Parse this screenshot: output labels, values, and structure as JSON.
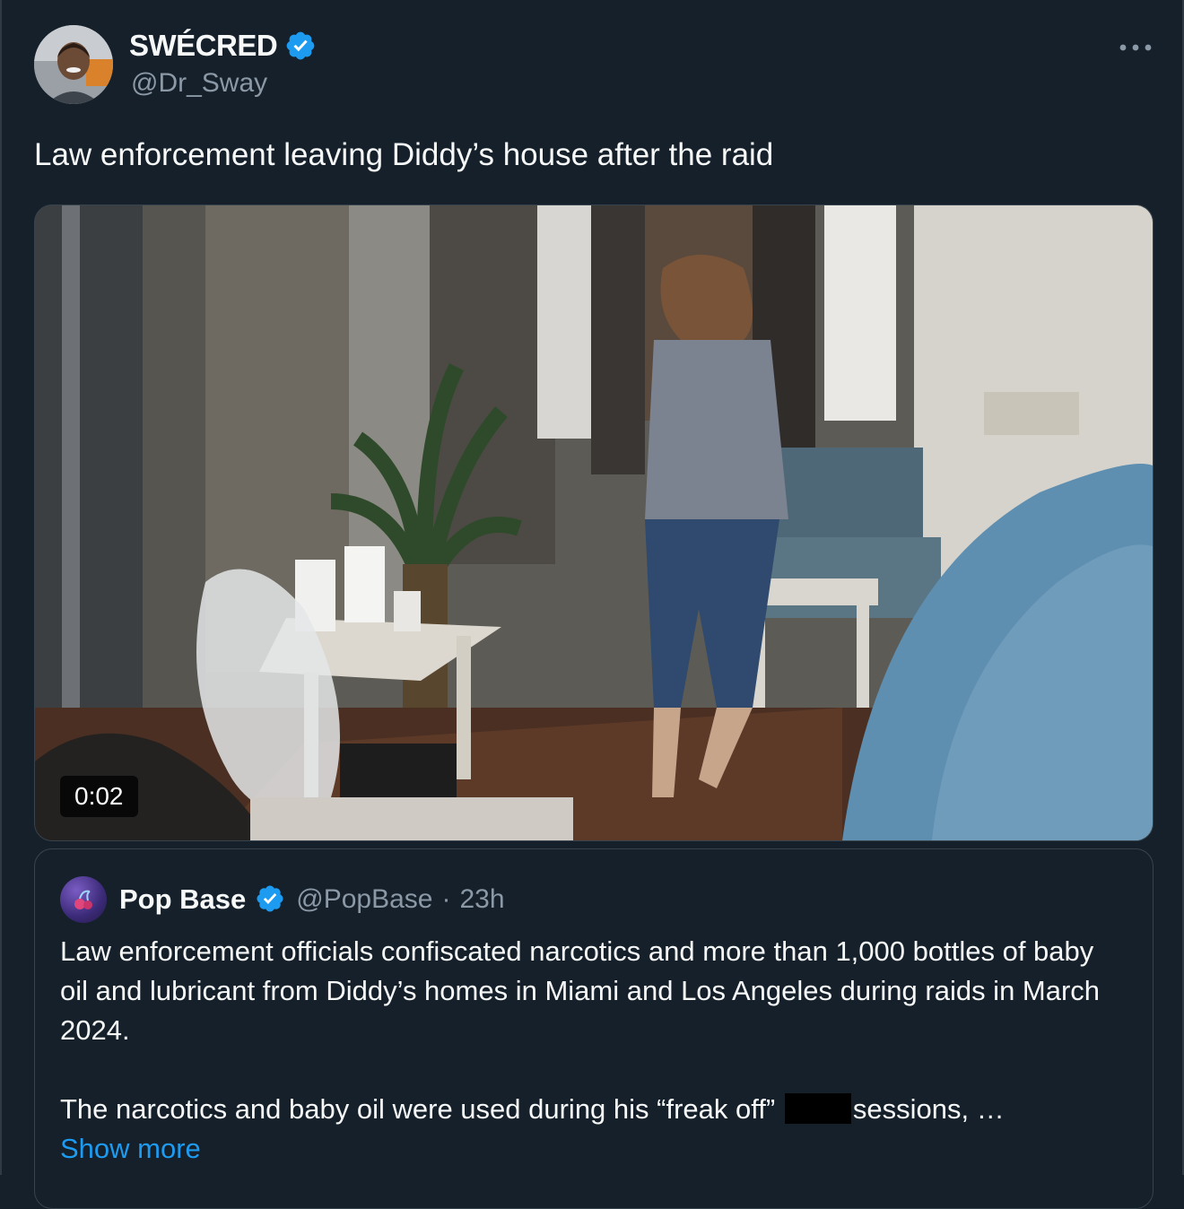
{
  "author": {
    "name": "SWÉCRED",
    "handle": "@Dr_Sway",
    "verified": true
  },
  "tweet": {
    "text": "Law enforcement leaving Diddy’s house after the raid"
  },
  "media": {
    "type": "video",
    "duration": "0:02"
  },
  "quoted": {
    "name": "Pop Base",
    "handle": "@PopBase",
    "separator": "·",
    "time": "23h",
    "verified": true,
    "paragraph1": "Law enforcement officials confiscated narcotics and more than 1,000 bottles of baby oil and lubricant from Diddy’s homes in Miami and Los Angeles during raids in March 2024.",
    "paragraph2_before": "The narcotics and baby oil were used during his “freak off”",
    "paragraph2_after": "sessions, …",
    "show_more": "Show more"
  },
  "colors": {
    "background": "#15202b",
    "text": "#f7f9f9",
    "muted": "#8b98a5",
    "accent": "#1d9bf0",
    "border": "#38444d"
  },
  "icons": {
    "verified": "verified-badge-icon",
    "more": "more-dots-icon",
    "avatar_quoted": "pop-base-logo"
  }
}
